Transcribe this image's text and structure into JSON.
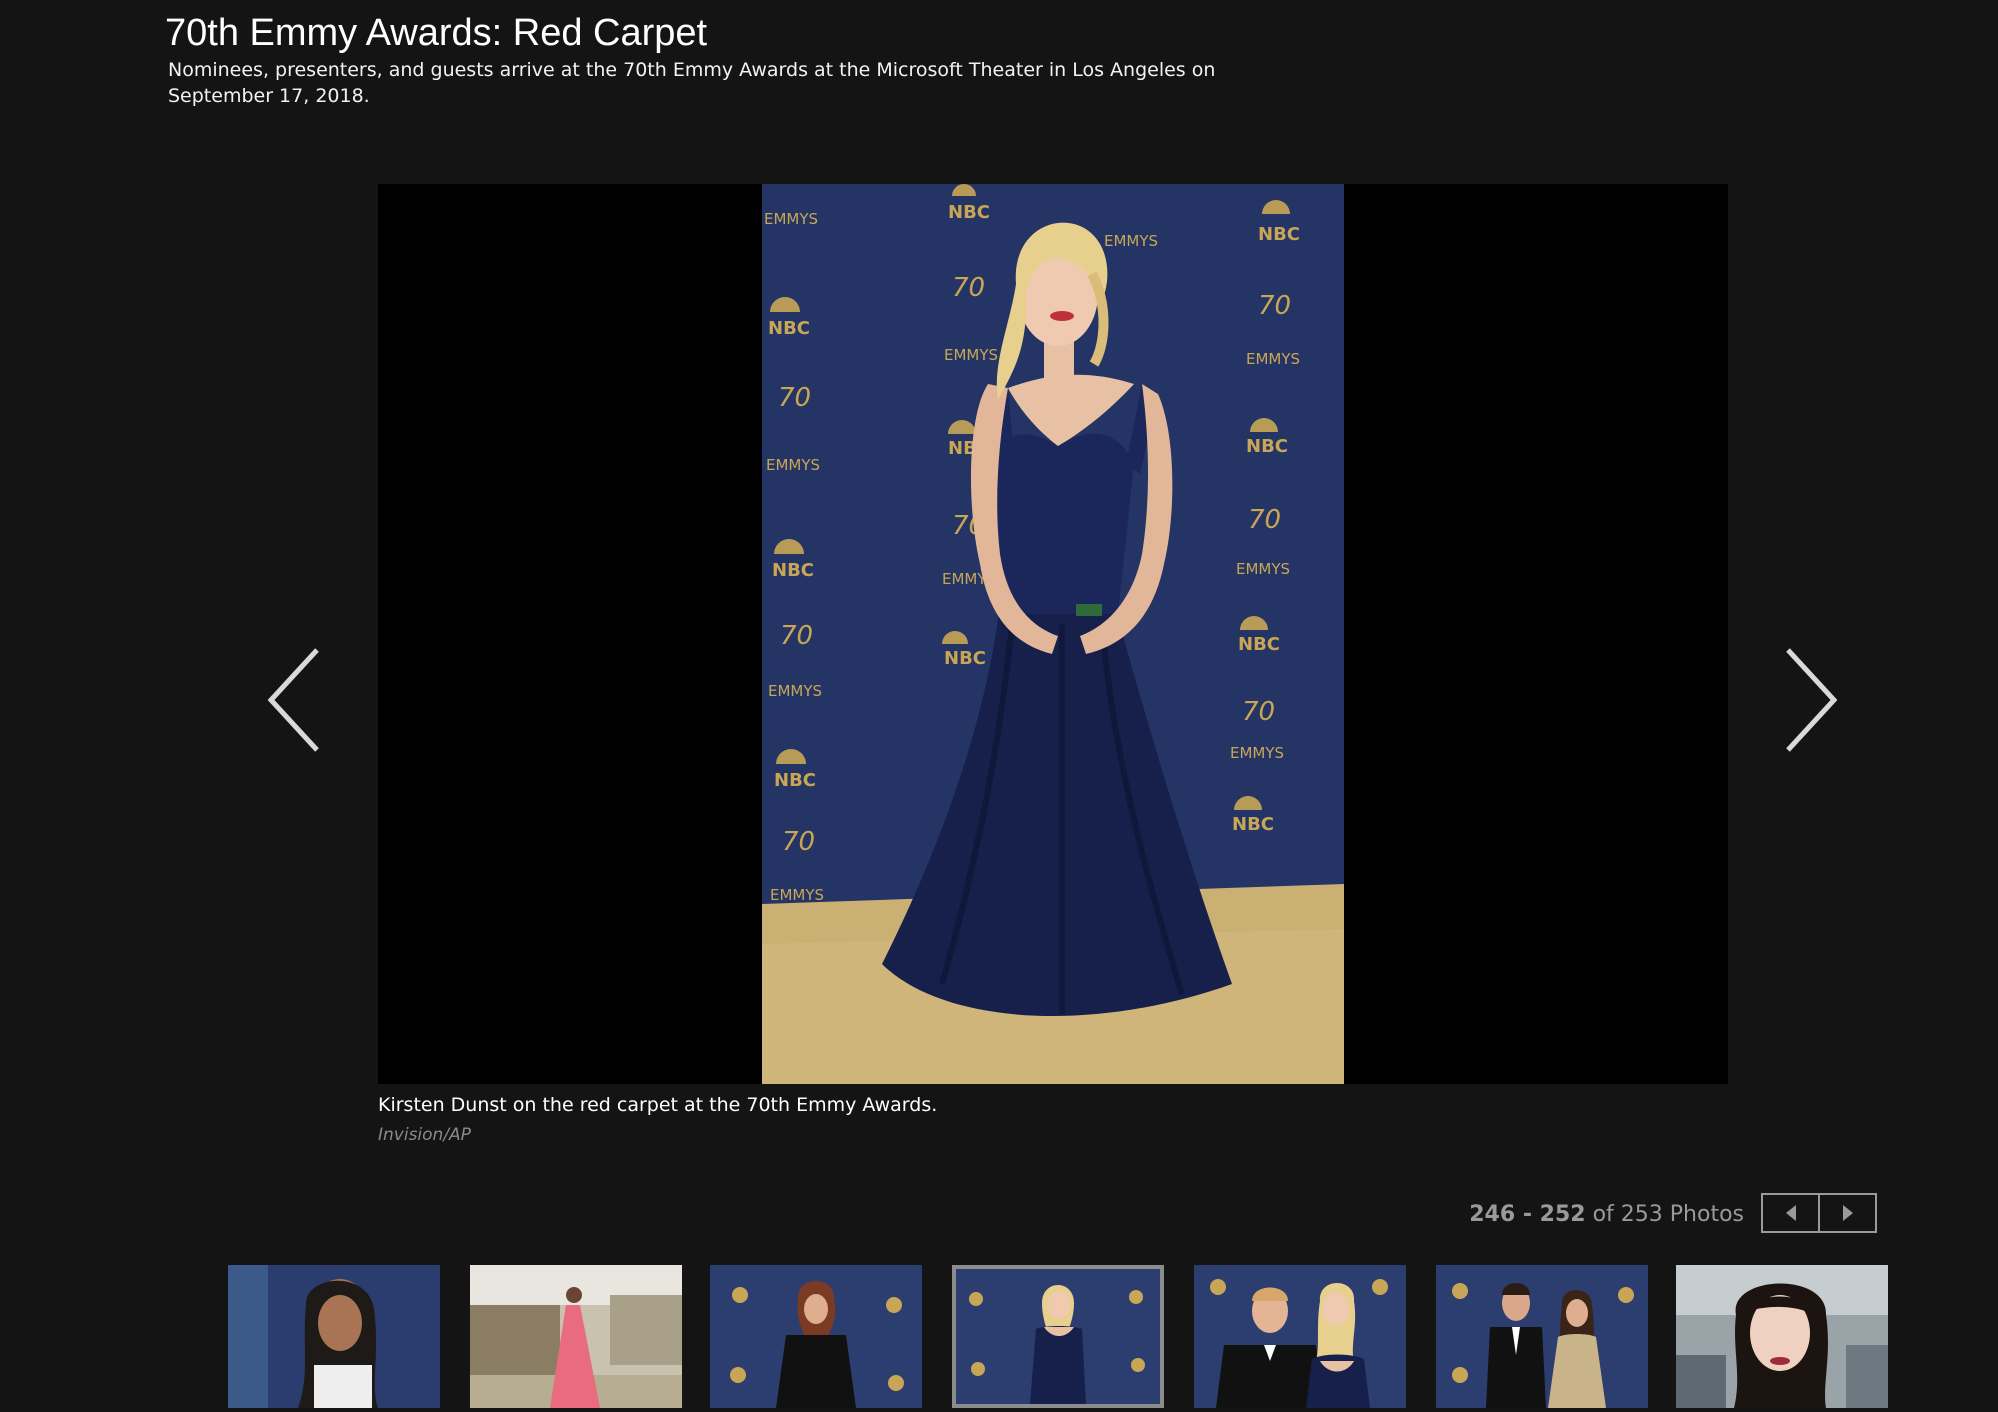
{
  "gallery": {
    "title": "70th Emmy Awards: Red Carpet",
    "description": "Nominees, presenters, and guests arrive at the 70th Emmy Awards at the Microsoft Theater in Los Angeles on September 17, 2018."
  },
  "current_photo": {
    "caption": "Kirsten Dunst on the red carpet at the 70th Emmy Awards.",
    "credit": "Invision/AP",
    "backdrop_labels": {
      "network": "NBC",
      "award": "EMMYS",
      "anniversary": "70"
    }
  },
  "pagination": {
    "range_start": "246",
    "range_separator": " - ",
    "range_end": "252",
    "of_text": " of ",
    "total": "253",
    "unit": " Photos"
  },
  "controls": {
    "prev_icon": "chevron-left-icon",
    "next_icon": "chevron-right-icon",
    "pager_prev_icon": "caret-left-icon",
    "pager_next_icon": "caret-right-icon"
  },
  "thumbnails_active_index": 3,
  "colors": {
    "background": "#141414",
    "viewer": "#000000",
    "backdrop_navy": "#27386b",
    "logo_gold": "#c9a655",
    "carpet_gold": "#cbb073",
    "muted_text": "#9a9a9a"
  }
}
